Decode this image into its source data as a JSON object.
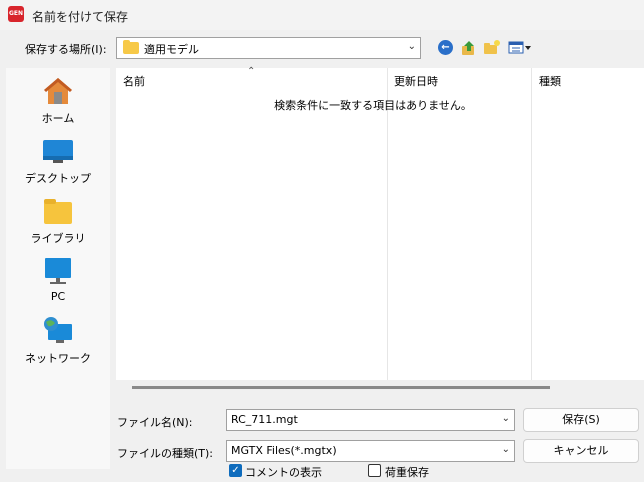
{
  "window": {
    "app_icon_text": "GEN",
    "title": "名前を付けて保存"
  },
  "lookin": {
    "label": "保存する場所(I):",
    "value": "適用モデル"
  },
  "places": [
    {
      "label": "ホーム",
      "icon": "home-icon"
    },
    {
      "label": "デスクトップ",
      "icon": "desktop-icon"
    },
    {
      "label": "ライブラリ",
      "icon": "library-icon"
    },
    {
      "label": "PC",
      "icon": "pc-icon"
    },
    {
      "label": "ネットワーク",
      "icon": "network-icon"
    }
  ],
  "filelist": {
    "columns": [
      "名前",
      "更新日時",
      "種類"
    ],
    "empty_message": "検索条件に一致する項目はありません。"
  },
  "filename": {
    "label": "ファイル名(N):",
    "value": "RC_711.mgt"
  },
  "filetype": {
    "label": "ファイルの種類(T):",
    "value": "MGTX Files(*.mgtx)"
  },
  "buttons": {
    "save": "保存(S)",
    "cancel": "キャンセル"
  },
  "options": {
    "show_comment": {
      "label": "コメントの表示",
      "checked": true
    },
    "load_save": {
      "label": "荷重保存",
      "checked": false
    }
  },
  "colors": {
    "accent": "#0f6cbd",
    "app_icon": "#d8252c",
    "folder": "#f7c948"
  }
}
